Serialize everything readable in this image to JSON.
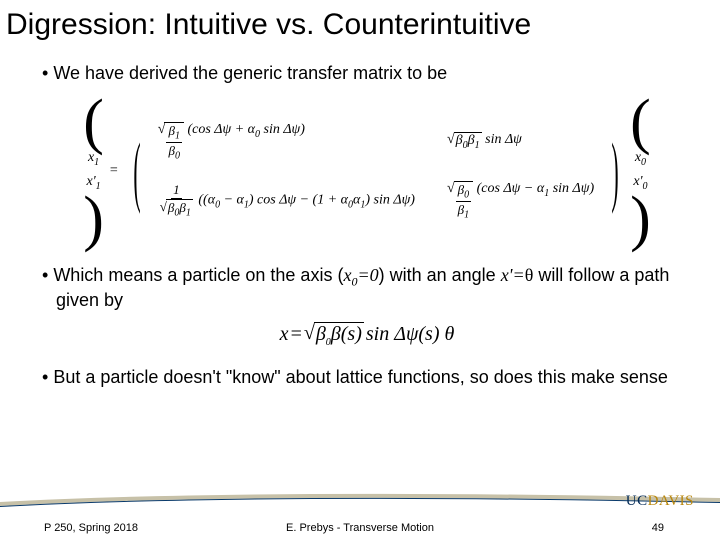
{
  "title": "Digression: Intuitive vs. Counterintuitive",
  "bullets": {
    "b1": "We have derived the generic transfer matrix to be",
    "b2_pre": "Which means a particle on the axis (",
    "b2_x0": "x",
    "b2_x0sub": "0",
    "b2_eq0": "=0",
    "b2_mid": ") with an angle ",
    "b2_xprime": "x'=",
    "b2_theta": "θ",
    "b2_post": " will follow a path given by",
    "b3": "But a particle doesn't \"know\" about lattice functions, so does this make sense"
  },
  "matrix": {
    "lhs_top": "x",
    "lhs_top_sub": "1",
    "lhs_bot": "x'",
    "lhs_bot_sub": "1",
    "rhs_top": "x",
    "rhs_top_sub": "0",
    "rhs_bot": "x'",
    "rhs_bot_sub": "0",
    "m11_a": "β",
    "m11_a_sub": "1",
    "m11_b": "β",
    "m11_b_sub": "0",
    "m11_c": "(cos Δψ + α",
    "m11_c_sub": "0",
    "m11_d": " sin Δψ)",
    "m12_a": "β",
    "m12_a_sub": "0",
    "m12_b": "β",
    "m12_b_sub": "1",
    "m12_c": " sin Δψ",
    "m21_a": "1",
    "m21_b": "β",
    "m21_b_sub": "0",
    "m21_c": "β",
    "m21_c_sub": "1",
    "m21_d": "((α",
    "m21_d_sub": "0",
    "m21_e": " − α",
    "m21_e_sub": "1",
    "m21_f": ") cos Δψ − (1 + α",
    "m21_f_sub": "0",
    "m21_g": "α",
    "m21_g_sub": "1",
    "m21_h": ") sin Δψ)",
    "m22_a": "β",
    "m22_a_sub": "0",
    "m22_b": "β",
    "m22_b_sub": "1",
    "m22_c": "(cos Δψ − α",
    "m22_c_sub": "1",
    "m22_d": " sin Δψ)"
  },
  "eq2": {
    "lhs": "x",
    "eq": " = ",
    "r1": "β",
    "r1_sub": "0",
    "r2": "β(s)",
    "r3": " sin Δψ(s) θ"
  },
  "footer": {
    "left": "P 250, Spring 2018",
    "center": "E. Prebys - Transverse Motion",
    "right": "49"
  },
  "logo": {
    "uc": "UC",
    "davis": "DAVIS"
  },
  "chart_data": null
}
